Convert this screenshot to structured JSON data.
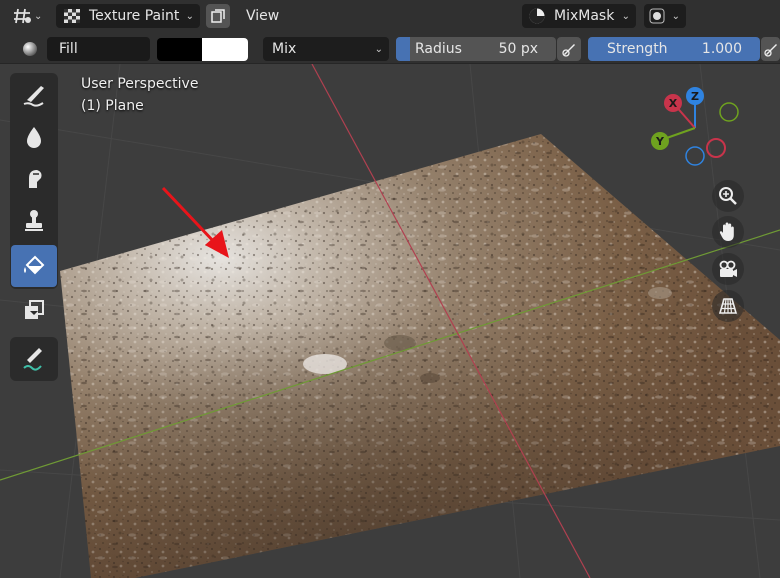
{
  "header": {
    "mode_label": "Texture Paint",
    "view_menu": "View",
    "mask_label": "MixMask"
  },
  "toolbar": {
    "brush_name": "Fill",
    "blend_mode": "Mix",
    "radius_label": "Radius",
    "radius_value": "50 px",
    "strength_label": "Strength",
    "strength_value": "1.000",
    "primary_color": "#000000",
    "secondary_color": "#ffffff",
    "accent_color": "#4772b3"
  },
  "viewport": {
    "view_name": "User Perspective",
    "object_name": "(1) Plane"
  },
  "gizmo": {
    "x_label": "X",
    "y_label": "Y",
    "z_label": "Z",
    "x_color": "#c8344b",
    "y_color": "#6fa21f",
    "z_color": "#2f83e0"
  },
  "tools": [
    {
      "name": "draw-brush-icon",
      "active": false
    },
    {
      "name": "soften-brush-icon",
      "active": false
    },
    {
      "name": "smear-brush-icon",
      "active": false
    },
    {
      "name": "clone-stamp-icon",
      "active": false
    },
    {
      "name": "fill-bucket-icon",
      "active": true
    },
    {
      "name": "mask-icon",
      "active": false
    },
    {
      "name": "annotate-icon",
      "active": false
    }
  ],
  "nav_icons": [
    "zoom-icon",
    "hand-pan-icon",
    "camera-view-icon",
    "perspective-grid-icon"
  ]
}
